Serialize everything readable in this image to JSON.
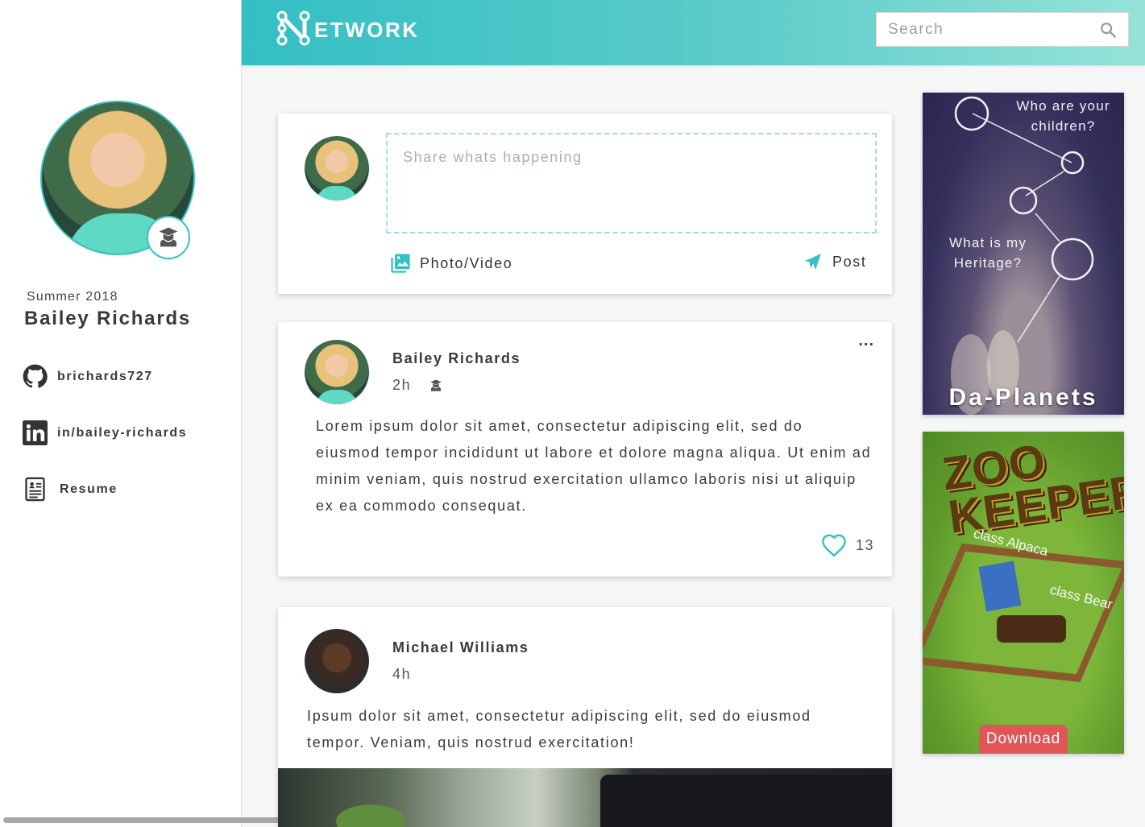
{
  "brand": {
    "logo_letter": "N",
    "logo_rest": "ETWORK"
  },
  "search": {
    "placeholder": "Search"
  },
  "profile": {
    "term": "Summer 2018",
    "name": "Bailey Richards",
    "links": [
      {
        "icon": "github-icon",
        "label": "brichards727"
      },
      {
        "icon": "linkedin-icon",
        "label": "in/bailey-richards"
      },
      {
        "icon": "resume-icon",
        "label": "Resume"
      }
    ],
    "badge_icon": "graduate-icon"
  },
  "composer": {
    "placeholder": "Share whats happening",
    "photo_label": "Photo/Video",
    "post_label": "Post"
  },
  "posts": [
    {
      "author": "Bailey Richards",
      "time": "2h",
      "badge_icon": "graduate-icon",
      "menu": "...",
      "body": "Lorem ipsum dolor sit amet, consectetur adipiscing elit, sed do eiusmod tempor incididunt ut labore et dolore magna aliqua. Ut enim ad minim veniam, quis nostrud exercitation ullamco laboris nisi ut aliquip ex ea commodo consequat.",
      "likes": "13"
    },
    {
      "author": "Michael Williams",
      "time": "4h",
      "body": "Ipsum dolor sit amet, consectetur adipiscing elit, sed do eiusmod tempor. Veniam, quis nostrud exercitation!"
    }
  ],
  "ads": [
    {
      "question_1": "Who are your children?",
      "question_2": "What is my Heritage?",
      "title": "Da-Planets"
    },
    {
      "title": "ZOO KEEPER",
      "label_1": "class Alpaca",
      "label_2": "class Bear",
      "button": "Download"
    }
  ],
  "colors": {
    "accent": "#36c1c5",
    "header_end": "#95e3d8",
    "download": "#e05555"
  }
}
